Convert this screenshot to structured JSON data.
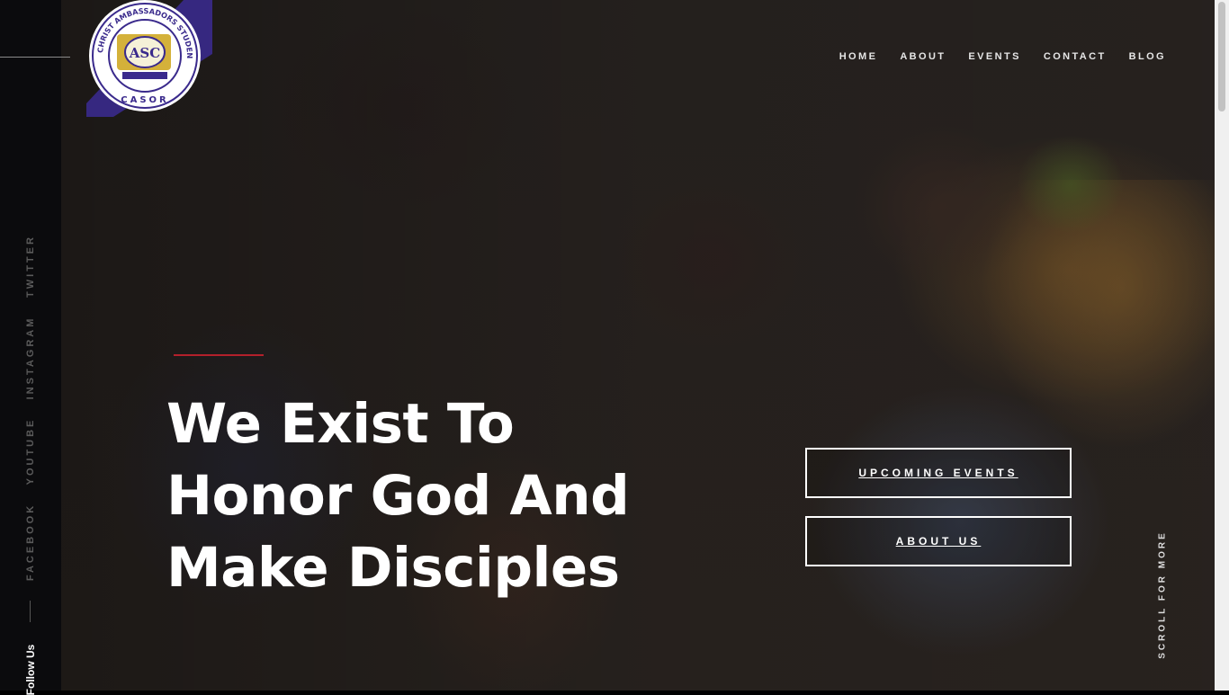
{
  "logo": {
    "ring_text": "CHRIST AMBASSADORS STUDENTS' OUTREACH",
    "bottom_text": "CASOR",
    "emblem_letters": "ASC",
    "colors": {
      "ring": "#3a2a8c",
      "badge": "#ffffff",
      "gold": "#d4b13a"
    }
  },
  "nav": {
    "items": [
      "HOME",
      "ABOUT",
      "EVENTS",
      "CONTACT",
      "BLOG"
    ]
  },
  "sidebar": {
    "social": [
      "TWITTER",
      "INSTAGRAM",
      "YOUTUBE",
      "FACEBOOK"
    ],
    "follow_label": "Follow Us"
  },
  "hero": {
    "headline_lines": [
      "We Exist To",
      "Honor God And",
      "Make Disciples"
    ],
    "accent_color": "#b3202b"
  },
  "buttons": {
    "upcoming": "UPCOMING EVENTS",
    "about": "ABOUT US"
  },
  "scroll_hint": "SCROLL FOR MORE"
}
